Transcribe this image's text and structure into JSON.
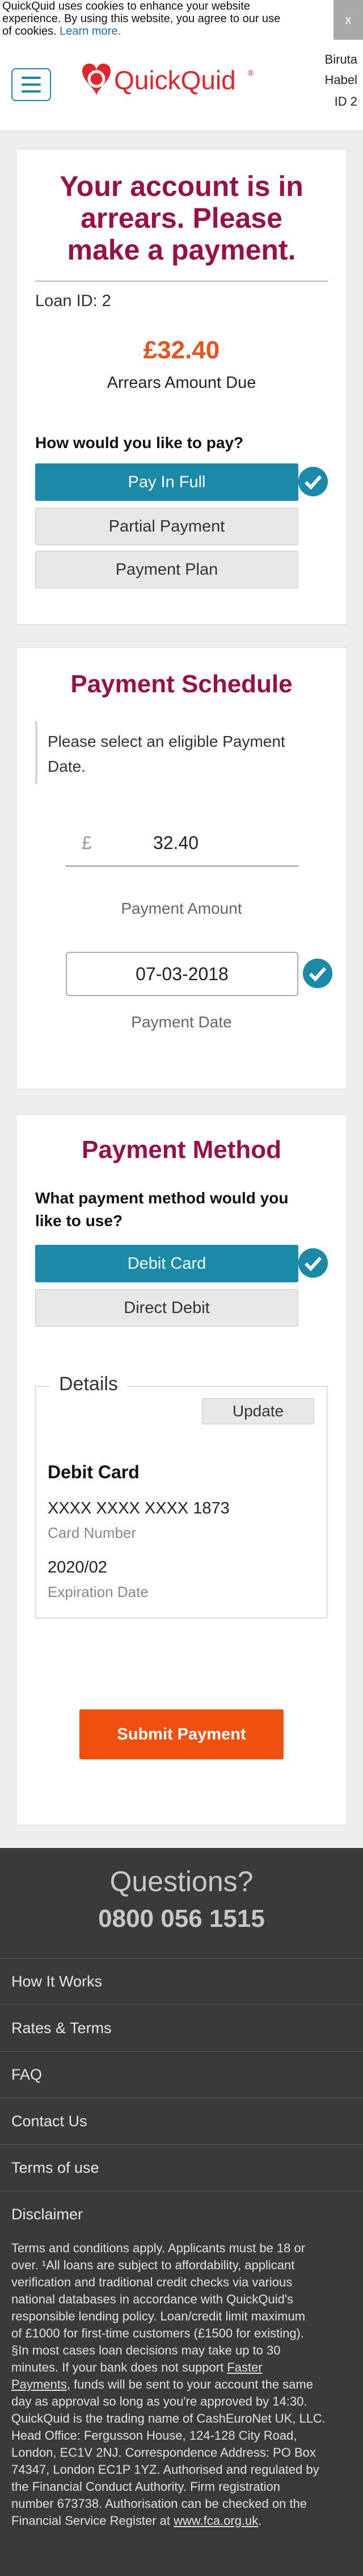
{
  "cookie": {
    "line1": "QuickQuid uses cookies to enhance your website",
    "line2": "experience. By using this website, you agree to our use",
    "line3_prefix": "of cookies. ",
    "learn_more": "Learn more.",
    "close": "x"
  },
  "header": {
    "brand": "QuickQuid",
    "trademark": "®",
    "user_first": "Biruta",
    "user_last": "Habel",
    "user_id": "ID 2"
  },
  "arrears": {
    "title_line1": "Your account is in",
    "title_line2": "arrears. Please",
    "title_line3": "make a payment.",
    "loan_id": "Loan ID: 2",
    "amount": "£32.40",
    "amount_label": "Arrears Amount Due",
    "question": "How would you like to pay?",
    "options": [
      "Pay In Full",
      "Partial Payment",
      "Payment Plan"
    ]
  },
  "schedule": {
    "title": "Payment Schedule",
    "instruction_line1": "Please select an eligible Payment",
    "instruction_line2": "Date.",
    "currency": "£",
    "amount_value": "32.40",
    "amount_label": "Payment Amount",
    "date_value": "07-03-2018",
    "date_label": "Payment Date"
  },
  "method": {
    "title": "Payment Method",
    "question_line1": "What payment method would you",
    "question_line2": "like to use?",
    "options": [
      "Debit Card",
      "Direct Debit"
    ],
    "details_legend": "Details",
    "update_label": "Update",
    "card_type": "Debit Card",
    "card_number": "XXXX XXXX XXXX 1873",
    "card_number_label": "Card Number",
    "expiry": "2020/02",
    "expiry_label": "Expiration Date"
  },
  "submit_label": "Submit Payment",
  "footer": {
    "questions": "Questions?",
    "phone": "0800 056 1515",
    "nav": [
      "How It Works",
      "Rates & Terms",
      "FAQ",
      "Contact Us",
      "Terms of use",
      "Disclaimer"
    ],
    "legal_lines": [
      "Terms and conditions apply. Applicants must be 18 or",
      "over. ¹All loans are subject to affordability, applicant",
      "verification and traditional credit checks via various",
      "national databases in accordance with QuickQuid's",
      "responsible lending policy. Loan/credit limit maximum",
      "of £1000 for first-time customers (£1500 for existing).",
      "§In most cases loan decisions may take up to 30",
      "minutes. If your bank does not support "
    ],
    "faster_payments": "Faster",
    "faster_payments2": "Payments",
    "legal_lines2": [
      ", funds will be sent to your account the same",
      "day as approval so long as you're approved by 14:30.",
      "QuickQuid is the trading name of CashEuroNet UK, LLC.",
      "Head Office: Fergusson House, 124-128 City Road,",
      "London, EC1V 2NJ. Correspondence Address: PO Box",
      "74347, London EC1P 1YZ. Authorised and regulated by",
      "the Financial Conduct Authority. Firm registration",
      "number 673738. Authorisation can be checked on the",
      "Financial Service Register at "
    ],
    "fca_link": "www.fca.org.uk",
    "legal_end": "."
  },
  "colors": {
    "teal": "#1a8aa8",
    "heading": "#9a1045",
    "amount": "#e8531f",
    "submit": "#f0500f",
    "footer_bg": "#3a3a3a"
  }
}
